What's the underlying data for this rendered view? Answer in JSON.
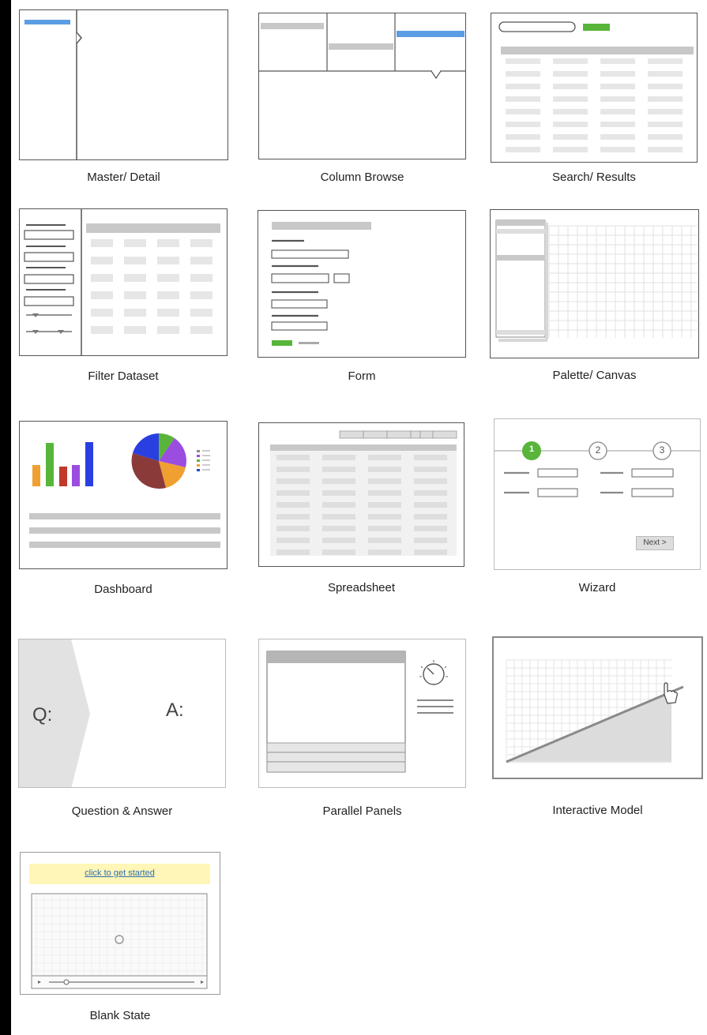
{
  "patterns": [
    {
      "key": "master_detail",
      "label": "Master/ Detail"
    },
    {
      "key": "column_browse",
      "label": "Column Browse"
    },
    {
      "key": "search_results",
      "label": "Search/ Results"
    },
    {
      "key": "filter_dataset",
      "label": "Filter Dataset"
    },
    {
      "key": "form",
      "label": "Form"
    },
    {
      "key": "palette_canvas",
      "label": "Palette/ Canvas"
    },
    {
      "key": "dashboard",
      "label": "Dashboard"
    },
    {
      "key": "spreadsheet",
      "label": "Spreadsheet"
    },
    {
      "key": "wizard",
      "label": "Wizard"
    },
    {
      "key": "question_answer",
      "label": "Question & Answer"
    },
    {
      "key": "parallel_panels",
      "label": "Parallel Panels"
    },
    {
      "key": "interactive_model",
      "label": "Interactive Model"
    },
    {
      "key": "blank_state",
      "label": "Blank State"
    }
  ],
  "wizard": {
    "steps": [
      "1",
      "2",
      "3"
    ],
    "next_label": "Next >"
  },
  "qa": {
    "q": "Q:",
    "a": "A:"
  },
  "blank_state": {
    "link": "click to get started"
  },
  "colors": {
    "blue": "#5b9de3",
    "green": "#58b53a",
    "gray": "#c8c8c8",
    "light": "#e8e8e8",
    "dark": "#555555"
  }
}
